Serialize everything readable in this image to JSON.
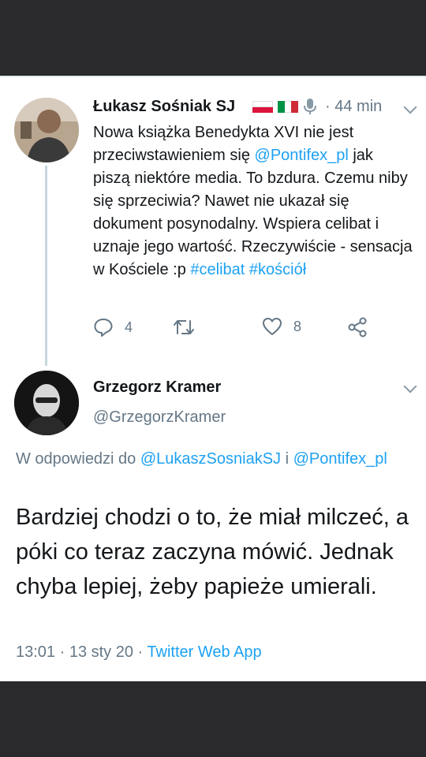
{
  "tweet1": {
    "author_name": "Łukasz Sośniak SJ",
    "separator": "·",
    "time_ago": "44 min",
    "text_intro": "Nowa książka Benedykta XVI nie jest przeciwstawieniem się ",
    "mention": "@Pontifex_pl",
    "text_body": " jak piszą niektóre media. To bzdura. Czemu niby się sprzeciwia? Nawet nie ukazał się dokument posynodalny. Wspiera celibat i uznaje jego wartość. Rzeczywiście - sensacja w Kościele :p",
    "hashtag1": "#celibat",
    "hashtag2": "#kościół",
    "reply_count": "4",
    "like_count": "8",
    "flags": [
      "poland-flag",
      "italy-flag",
      "microphone-icon"
    ]
  },
  "tweet2": {
    "author_name": "Grzegorz Kramer",
    "handle": "@GrzegorzKramer",
    "replying_prefix": "W odpowiedzi do ",
    "replying_user1": "@LukaszSosniakSJ",
    "replying_joiner": " i ",
    "replying_user2": "@Pontifex_pl",
    "text": "Bardziej chodzi o to, że miał milczeć, a póki co teraz zaczyna mówić. Jednak chyba lepiej, żeby papieże umierali.",
    "timestamp": "13:01 · 13 sty 20 · ",
    "client": "Twitter Web App"
  },
  "colors": {
    "background": "#2a2a2d",
    "card": "#ffffff",
    "link": "#1da1f2",
    "muted": "#657786",
    "text": "#14171a"
  }
}
